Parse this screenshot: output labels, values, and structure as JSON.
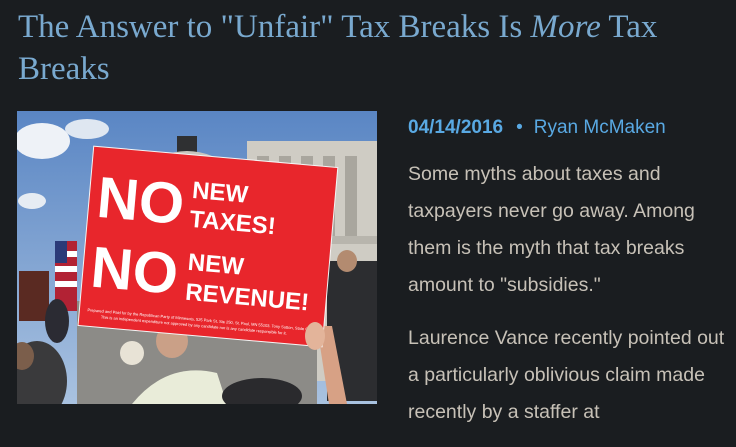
{
  "article": {
    "title_part1": "The Answer to \"Unfair\" Tax Breaks Is ",
    "title_emphasis": "More",
    "title_part2": " Tax Breaks",
    "date": "04/14/2016",
    "separator": "•",
    "author": "Ryan McMaken",
    "paragraphs": [
      "Some myths about taxes and taxpayers never go away. Among them is the myth that tax breaks amount to \"subsidies.\"",
      "Laurence Vance recently pointed out a particularly oblivious claim made recently by a staffer at"
    ]
  },
  "image": {
    "sign_line1_big": "NO",
    "sign_line1_small1": "NEW",
    "sign_line1_small2": "TAXES!",
    "sign_line2_big": "NO",
    "sign_line2_small1": "NEW",
    "sign_line2_small2": "REVENUE!",
    "sign_fineprint1": "Prepared and Paid for by the Republican Party of Minnesota, 525 Park St, Ste 250, St. Paul, MN 55103. Tony Sutton, State Ch",
    "sign_fineprint2": "This is an independent expenditure not approved by any candidate nor is any candidate responsible for it."
  },
  "colors": {
    "background": "#1a1d20",
    "title": "#79a9cf",
    "accent": "#59a9e3",
    "body_text": "#c7c1b7",
    "sign_red": "#e8262c"
  }
}
